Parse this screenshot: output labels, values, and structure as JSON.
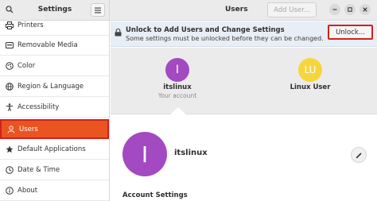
{
  "header": {
    "sidebar_title": "Settings",
    "main_title": "Users",
    "add_user_label": "Add User..."
  },
  "sidebar": {
    "items": [
      {
        "label": "Printers",
        "icon": "printer-icon"
      },
      {
        "label": "Removable Media",
        "icon": "removable-media-icon"
      },
      {
        "label": "Color",
        "icon": "color-icon"
      },
      {
        "label": "Region & Language",
        "icon": "globe-icon"
      },
      {
        "label": "Accessibility",
        "icon": "accessibility-icon"
      },
      {
        "label": "Users",
        "icon": "user-icon",
        "active": true
      },
      {
        "label": "Default Applications",
        "icon": "star-icon"
      },
      {
        "label": "Date & Time",
        "icon": "clock-icon"
      },
      {
        "label": "About",
        "icon": "info-icon"
      }
    ]
  },
  "infobar": {
    "title": "Unlock to Add Users and Change Settings",
    "subtitle": "Some settings must be unlocked before they can be changed.",
    "unlock_label": "Unlock..."
  },
  "users": [
    {
      "initials": "I",
      "name": "itslinux",
      "subtitle": "Your account",
      "color": "#a349c1"
    },
    {
      "initials": "LU",
      "name": "Linux User",
      "subtitle": "",
      "color": "#f5d63d"
    }
  ],
  "detail": {
    "initials": "I",
    "name": "itslinux",
    "section_title": "Account Settings"
  },
  "colors": {
    "accent": "#e95420",
    "highlight_border": "#d0221b"
  }
}
